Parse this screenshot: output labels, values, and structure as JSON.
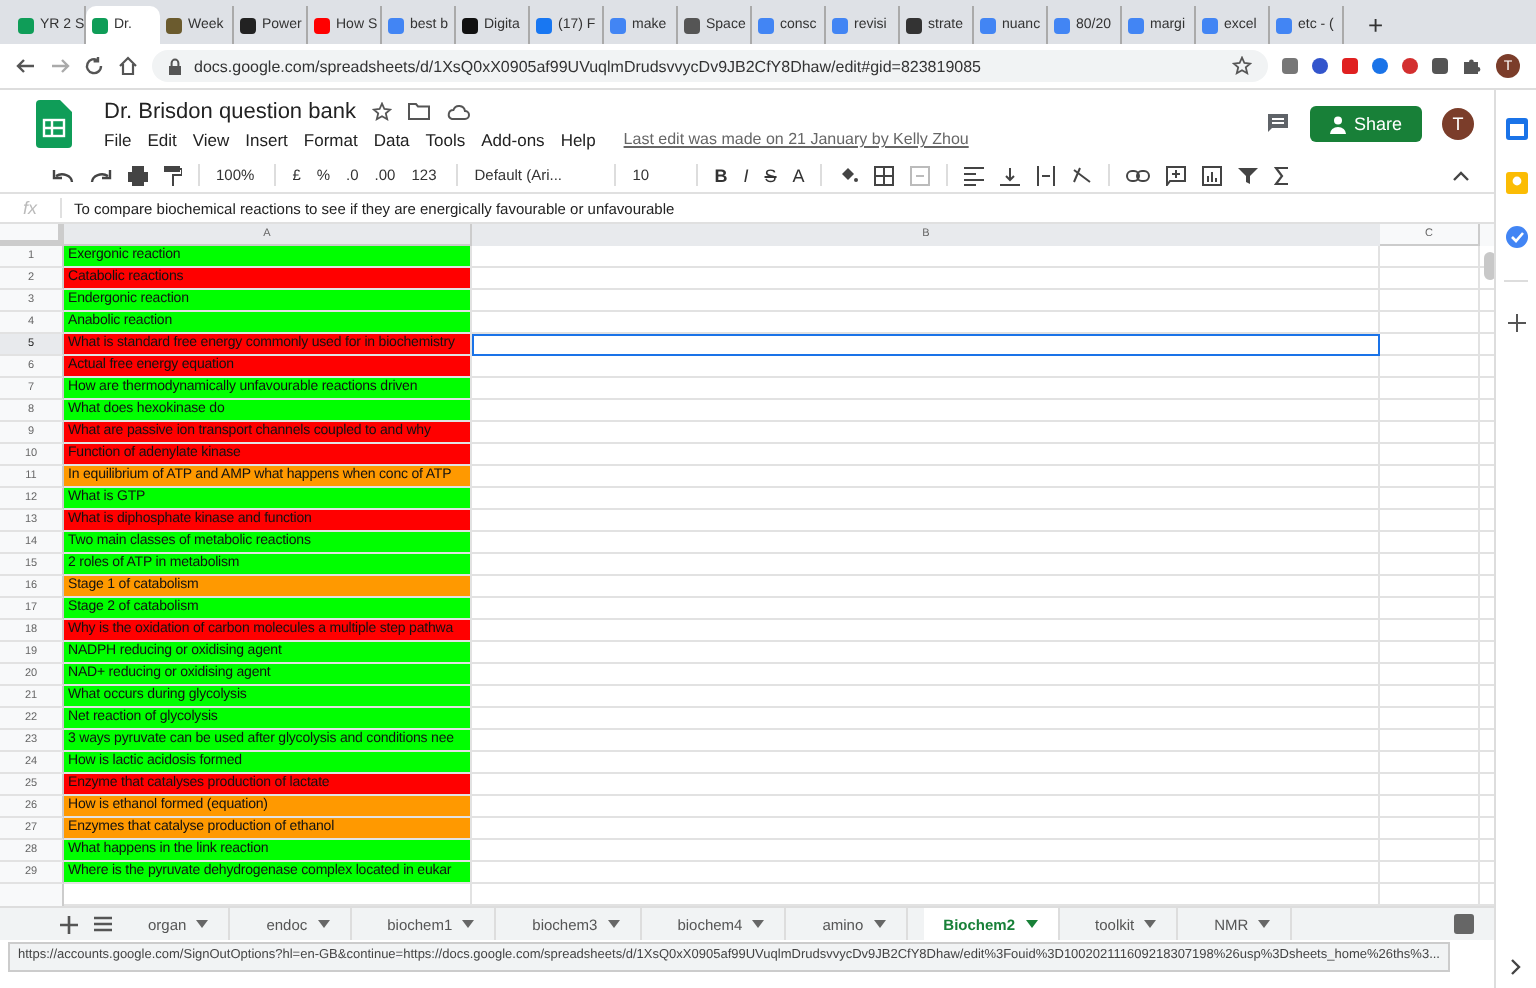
{
  "browser_tabs": [
    {
      "label": "YR 2 S",
      "selected": false,
      "color": "#0f9d58"
    },
    {
      "label": "Dr.",
      "selected": true,
      "color": "#0f9d58"
    },
    {
      "label": "Week",
      "selected": false,
      "color": "#6b5b2e"
    },
    {
      "label": "Power",
      "selected": false,
      "color": "#222222"
    },
    {
      "label": "How S",
      "selected": false,
      "color": "#ff0000"
    },
    {
      "label": "best b",
      "selected": false,
      "color": "#4285f4"
    },
    {
      "label": "Digita",
      "selected": false,
      "color": "#111111"
    },
    {
      "label": "(17) F",
      "selected": false,
      "color": "#1877f2"
    },
    {
      "label": "make",
      "selected": false,
      "color": "#4285f4"
    },
    {
      "label": "Space",
      "selected": false,
      "color": "#555555"
    },
    {
      "label": "consc",
      "selected": false,
      "color": "#4285f4"
    },
    {
      "label": "revisi",
      "selected": false,
      "color": "#4285f4"
    },
    {
      "label": "strate",
      "selected": false,
      "color": "#333333"
    },
    {
      "label": "nuanc",
      "selected": false,
      "color": "#4285f4"
    },
    {
      "label": "80/20",
      "selected": false,
      "color": "#4285f4"
    },
    {
      "label": "margi",
      "selected": false,
      "color": "#4285f4"
    },
    {
      "label": "excel",
      "selected": false,
      "color": "#4285f4"
    },
    {
      "label": "etc - (",
      "selected": false,
      "color": "#4285f4"
    }
  ],
  "new_tab": "+",
  "address_bar": {
    "url": "docs.google.com/spreadsheets/d/1XsQ0xX0905af99UVuqlmDrudsvvycDv9JB2CfY8Dhaw/edit#gid=823819085",
    "avatar": "T"
  },
  "document": {
    "title": "Dr. Brisdon question bank",
    "last_edit": "Last edit was made on 21 January by Kelly Zhou",
    "share": "Share",
    "avatar": "T"
  },
  "menu": [
    "File",
    "Edit",
    "View",
    "Insert",
    "Format",
    "Data",
    "Tools",
    "Add-ons",
    "Help"
  ],
  "toolbar": {
    "zoom": "100%",
    "currency": "£",
    "percent": "%",
    "decimal_less": ".0",
    "decimal_more": ".00",
    "format": "123",
    "font": "Default (Ari...",
    "font_size": "10",
    "bold": "B",
    "italic": "I",
    "strike": "S",
    "text_color": "A"
  },
  "formula_bar": {
    "label": "fx",
    "value": "To compare biochemical reactions to see if they are energically favourable or unfavourable"
  },
  "columns": [
    "A",
    "B",
    "C"
  ],
  "rows": [
    {
      "number": "1",
      "text": "Exergonic reaction",
      "color": "#00ff00",
      "selected": false
    },
    {
      "number": "2",
      "text": "Catabolic reactions",
      "color": "#ff0000",
      "selected": false
    },
    {
      "number": "3",
      "text": "Endergonic reaction",
      "color": "#00ff00",
      "selected": false
    },
    {
      "number": "4",
      "text": "Anabolic reaction",
      "color": "#00ff00",
      "selected": false
    },
    {
      "number": "5",
      "text": "What is standard free energy commonly used for in biochemistry",
      "color": "#ff0000",
      "selected": true
    },
    {
      "number": "6",
      "text": "Actual free energy equation",
      "color": "#ff0000",
      "selected": false
    },
    {
      "number": "7",
      "text": "How are thermodynamically unfavourable reactions driven",
      "color": "#00ff00",
      "selected": false
    },
    {
      "number": "8",
      "text": "What does hexokinase do",
      "color": "#00ff00",
      "selected": false
    },
    {
      "number": "9",
      "text": "What are passive ion transport channels coupled to and why",
      "color": "#ff0000",
      "selected": false
    },
    {
      "number": "10",
      "text": "Function of adenylate kinase",
      "color": "#ff0000",
      "selected": false
    },
    {
      "number": "11",
      "text": "In equilibrium of ATP and AMP what happens when conc of ATP",
      "color": "#ff9900",
      "selected": false
    },
    {
      "number": "12",
      "text": "What is GTP",
      "color": "#00ff00",
      "selected": false
    },
    {
      "number": "13",
      "text": "What is diphosphate kinase and function",
      "color": "#ff0000",
      "selected": false
    },
    {
      "number": "14",
      "text": "Two main classes of metabolic reactions",
      "color": "#00ff00",
      "selected": false
    },
    {
      "number": "15",
      "text": "2 roles of ATP in metabolism",
      "color": "#00ff00",
      "selected": false
    },
    {
      "number": "16",
      "text": "Stage 1 of catabolism",
      "color": "#ff9900",
      "selected": false
    },
    {
      "number": "17",
      "text": "Stage 2 of catabolism",
      "color": "#00ff00",
      "selected": false
    },
    {
      "number": "18",
      "text": "Why is the oxidation of carbon molecules a multiple step pathwa",
      "color": "#ff0000",
      "selected": false
    },
    {
      "number": "19",
      "text": "NADPH reducing or oxidising agent",
      "color": "#00ff00",
      "selected": false
    },
    {
      "number": "20",
      "text": "NAD+ reducing or oxidising agent",
      "color": "#00ff00",
      "selected": false
    },
    {
      "number": "21",
      "text": "What occurs during glycolysis",
      "color": "#00ff00",
      "selected": false
    },
    {
      "number": "22",
      "text": "Net reaction of glycolysis",
      "color": "#00ff00",
      "selected": false
    },
    {
      "number": "23",
      "text": "3 ways pyruvate can be used after glycolysis and conditions nee",
      "color": "#00ff00",
      "selected": false
    },
    {
      "number": "24",
      "text": "How is lactic acidosis formed",
      "color": "#00ff00",
      "selected": false
    },
    {
      "number": "25",
      "text": "Enzyme that catalyses production of lactate",
      "color": "#ff0000",
      "selected": false
    },
    {
      "number": "26",
      "text": "How is ethanol formed (equation)",
      "color": "#ff9900",
      "selected": false
    },
    {
      "number": "27",
      "text": "Enzymes that catalyse production of ethanol",
      "color": "#ff9900",
      "selected": false
    },
    {
      "number": "28",
      "text": "What happens in the link reaction",
      "color": "#00ff00",
      "selected": false
    },
    {
      "number": "29",
      "text": "Where is the pyruvate dehydrogenase complex located in eukar",
      "color": "#00ff00",
      "selected": false
    }
  ],
  "sheet_tabs": [
    {
      "label": "organ",
      "selected": false
    },
    {
      "label": "endoc",
      "selected": false
    },
    {
      "label": "biochem1",
      "selected": false
    },
    {
      "label": "biochem3",
      "selected": false
    },
    {
      "label": "biochem4",
      "selected": false
    },
    {
      "label": "amino",
      "selected": false
    },
    {
      "label": "Biochem2",
      "selected": true
    },
    {
      "label": "toolkit",
      "selected": false
    },
    {
      "label": "NMR",
      "selected": false
    }
  ],
  "status_url": "https://accounts.google.com/SignOutOptions?hl=en-GB&continue=https://docs.google.com/spreadsheets/d/1XsQ0xX0905af99UVuqlmDrudsvvycDv9JB2CfY8Dhaw/edit%3Fouid%3D100202111609218307198%26usp%3Dsheets_home%26ths%3..."
}
